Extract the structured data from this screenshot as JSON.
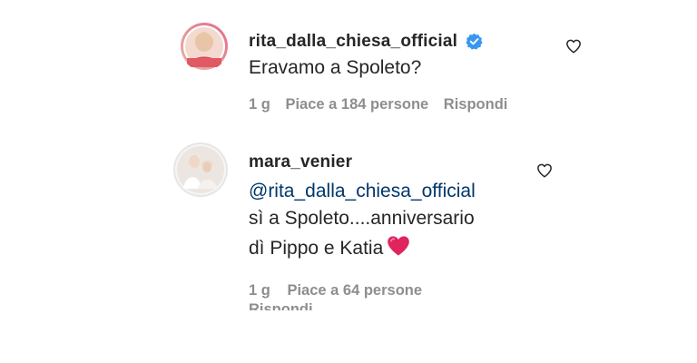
{
  "comments": [
    {
      "username": "rita_dalla_chiesa_official",
      "verified": true,
      "lines": [
        "Eravamo a Spoleto?"
      ],
      "time": "1 g",
      "likes": "Piace a 184 persone",
      "reply": "Rispondi",
      "avatar_icon": "avatar-woman-blonde"
    },
    {
      "username": "mara_venier",
      "verified": false,
      "mention": "@rita_dalla_chiesa_official",
      "lines": [
        "sì a Spoleto....anniversario",
        "dì Pippo e Katia"
      ],
      "emoji": "red-heart",
      "time": "1 g",
      "likes": "Piace a 64 persone",
      "reply": "Rispondi",
      "avatar_icon": "avatar-two-people"
    }
  ],
  "colors": {
    "text": "#262626",
    "secondary": "#8e8e8e",
    "mention": "#00376b",
    "verified": "#3897f0",
    "heart": "#e0245e"
  }
}
